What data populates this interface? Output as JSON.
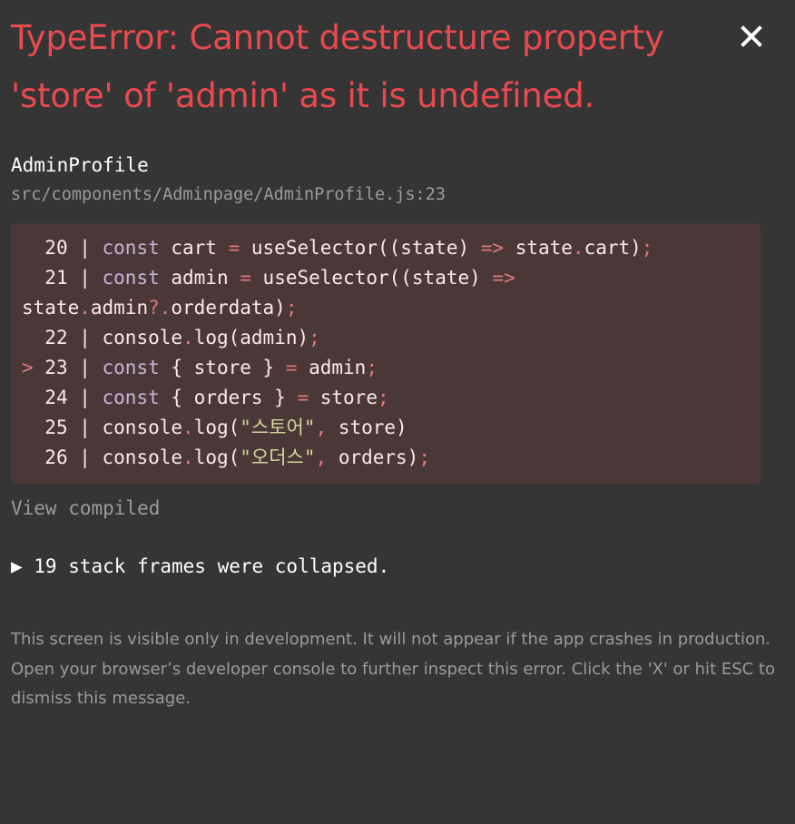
{
  "error": {
    "title": "TypeError: Cannot destructure property 'store' of 'admin' as it is undefined.",
    "component": "AdminProfile",
    "location": "src/components/Adminpage/AdminProfile.js:23"
  },
  "code": {
    "lines": [
      {
        "marker": " ",
        "num": "20",
        "tokens": [
          [
            "kw",
            "const"
          ],
          [
            "t",
            " cart "
          ],
          [
            "op",
            "="
          ],
          [
            "t",
            " useSelector((state) "
          ],
          [
            "op",
            "=>"
          ],
          [
            "t",
            " state"
          ],
          [
            "op",
            "."
          ],
          [
            "t",
            "cart)"
          ],
          [
            "op",
            ";"
          ]
        ]
      },
      {
        "marker": " ",
        "num": "21",
        "tokens": [
          [
            "kw",
            "const"
          ],
          [
            "t",
            " admin "
          ],
          [
            "op",
            "="
          ],
          [
            "t",
            " useSelector((state) "
          ],
          [
            "op",
            "=>"
          ]
        ]
      },
      {
        "marker": "",
        "num": "",
        "tokens": [
          [
            "t",
            "state"
          ],
          [
            "op",
            "."
          ],
          [
            "t",
            "admin"
          ],
          [
            "op",
            "?."
          ],
          [
            "t",
            "orderdata)"
          ],
          [
            "op",
            ";"
          ]
        ]
      },
      {
        "marker": " ",
        "num": "22",
        "tokens": [
          [
            "t",
            "console"
          ],
          [
            "op",
            "."
          ],
          [
            "t",
            "log(admin)"
          ],
          [
            "op",
            ";"
          ]
        ]
      },
      {
        "marker": ">",
        "num": "23",
        "tokens": [
          [
            "kw",
            "const"
          ],
          [
            "t",
            " { store } "
          ],
          [
            "op",
            "="
          ],
          [
            "t",
            " admin"
          ],
          [
            "op",
            ";"
          ]
        ]
      },
      {
        "marker": " ",
        "num": "24",
        "tokens": [
          [
            "kw",
            "const"
          ],
          [
            "t",
            " { orders } "
          ],
          [
            "op",
            "="
          ],
          [
            "t",
            " store"
          ],
          [
            "op",
            ";"
          ]
        ]
      },
      {
        "marker": " ",
        "num": "25",
        "tokens": [
          [
            "t",
            "console"
          ],
          [
            "op",
            "."
          ],
          [
            "t",
            "log("
          ],
          [
            "str",
            "\"스토어\""
          ],
          [
            "op",
            ","
          ],
          [
            "t",
            " store)"
          ]
        ]
      },
      {
        "marker": " ",
        "num": "26",
        "tokens": [
          [
            "t",
            "console"
          ],
          [
            "op",
            "."
          ],
          [
            "t",
            "log("
          ],
          [
            "str",
            "\"오더스\""
          ],
          [
            "op",
            ","
          ],
          [
            "t",
            " orders)"
          ],
          [
            "op",
            ";"
          ]
        ]
      }
    ]
  },
  "view_compiled_label": "View compiled",
  "stack_frames_label": "▶ 19 stack frames were collapsed.",
  "footer": {
    "line1": "This screen is visible only in development. It will not appear if the app crashes in production.",
    "line2": "Open your browser’s developer console to further inspect this error.  Click the 'X' or hit ESC to dismiss this message."
  },
  "colors": {
    "background": "#353535",
    "error_red": "#e84a4f",
    "code_bg": "#4a3838",
    "muted": "#9b9b9b"
  },
  "icons": {
    "close": "close-icon"
  }
}
